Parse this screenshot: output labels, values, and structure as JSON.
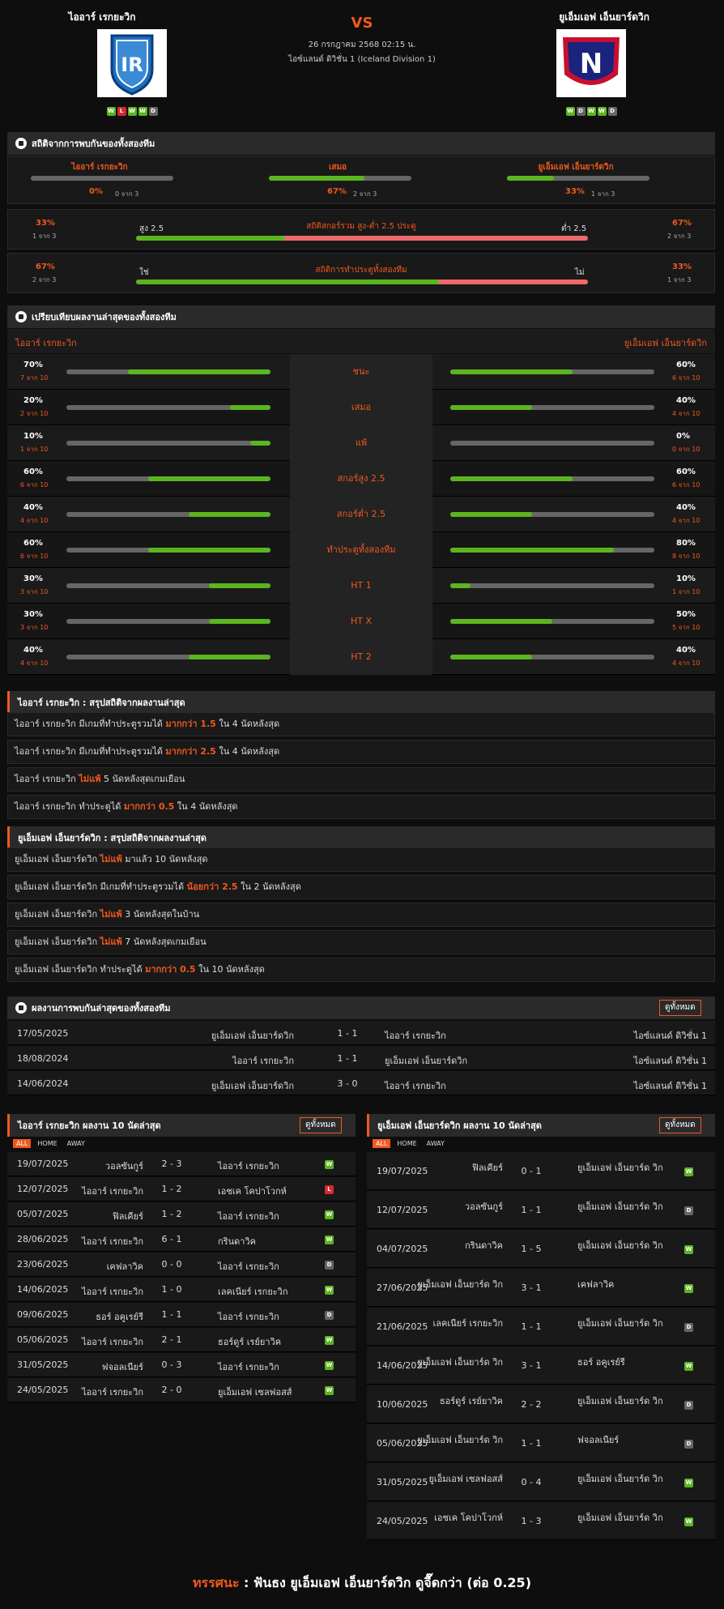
{
  "header": {
    "home": "ไออาร์ เรกยะวิก",
    "away": "ยูเอ็มเอฟ เอ็นยาร์ดวิก",
    "vs": "VS",
    "date": "26 กรกฎาคม 2568 02:15 น.",
    "league": "ไอซ์แลนด์ ดิวิชั่น 1 (Iceland Division 1)",
    "home_form": [
      "W",
      "L",
      "W",
      "W",
      "D"
    ],
    "away_form": [
      "W",
      "D",
      "W",
      "W",
      "D"
    ],
    "home_logo_text": "IR",
    "away_logo_text": "N"
  },
  "h2h_stats": {
    "title": "สถิติจากการพบกันของทั้งสองทีม",
    "cols": [
      {
        "name": "ไออาร์ เรกยะวิก",
        "pct": "0%",
        "sub": "0 จาก 3",
        "fill": 0
      },
      {
        "name": "เสมอ",
        "pct": "67%",
        "sub": "2 จาก 3",
        "fill": 0.67
      },
      {
        "name": "ยูเอ็มเอฟ เอ็นยาร์ดวิก",
        "pct": "33%",
        "sub": "1 จาก 3",
        "fill": 0.33
      }
    ],
    "ou": {
      "title": "สถิติสกอร์รวม สูง-ต่ำ 2.5 ประตู",
      "left_label": "สูง 2.5",
      "right_label": "ต่ำ 2.5",
      "left_pct": "33%",
      "left_sub": "1 จาก 3",
      "right_pct": "67%",
      "right_sub": "2 จาก 3",
      "fill": 0.33
    },
    "btts": {
      "title": "สถิติการทำประตูทั้งสองทีม",
      "left_label": "ใช่",
      "right_label": "ไม่",
      "left_pct": "67%",
      "left_sub": "2 จาก 3",
      "right_pct": "33%",
      "right_sub": "1 จาก 3",
      "fill": 0.67
    }
  },
  "compare": {
    "title": "เปรียบเทียบผลงานล่าสุดของทั้งสองทีม",
    "home": "ไออาร์ เรกยะวิก",
    "away": "ยูเอ็มเอฟ เอ็นยาร์ดวิก",
    "rows": [
      {
        "label": "ชนะ",
        "hp": "70%",
        "hs": "7 จาก 10",
        "hf": 0.7,
        "ap": "60%",
        "as": "6 จาก 10",
        "af": 0.6
      },
      {
        "label": "เสมอ",
        "hp": "20%",
        "hs": "2 จาก 10",
        "hf": 0.2,
        "ap": "40%",
        "as": "4 จาก 10",
        "af": 0.4
      },
      {
        "label": "แพ้",
        "hp": "10%",
        "hs": "1 จาก 10",
        "hf": 0.1,
        "ap": "0%",
        "as": "0 จาก 10",
        "af": 0
      },
      {
        "label": "สกอร์สูง 2.5",
        "hp": "60%",
        "hs": "6 จาก 10",
        "hf": 0.6,
        "ap": "60%",
        "as": "6 จาก 10",
        "af": 0.6
      },
      {
        "label": "สกอร์ต่ำ 2.5",
        "hp": "40%",
        "hs": "4 จาก 10",
        "hf": 0.4,
        "ap": "40%",
        "as": "4 จาก 10",
        "af": 0.4
      },
      {
        "label": "ทำประตูทั้งสองทีม",
        "hp": "60%",
        "hs": "6 จาก 10",
        "hf": 0.6,
        "ap": "80%",
        "as": "8 จาก 10",
        "af": 0.8
      },
      {
        "label": "HT 1",
        "hp": "30%",
        "hs": "3 จาก 10",
        "hf": 0.3,
        "ap": "10%",
        "as": "1 จาก 10",
        "af": 0.1
      },
      {
        "label": "HT X",
        "hp": "30%",
        "hs": "3 จาก 10",
        "hf": 0.3,
        "ap": "50%",
        "as": "5 จาก 10",
        "af": 0.5
      },
      {
        "label": "HT 2",
        "hp": "40%",
        "hs": "4 จาก 10",
        "hf": 0.4,
        "ap": "40%",
        "as": "4 จาก 10",
        "af": 0.4
      }
    ]
  },
  "home_summary": {
    "title": "ไออาร์ เรกยะวิก : สรุปสถิติจากผลงานล่าสุด",
    "lines": [
      [
        "ไออาร์ เรกยะวิก  มีเกมที่ทำประตูรวมได้ ",
        "มากกว่า 1.5",
        " ใน 4 นัดหลังสุด"
      ],
      [
        "ไออาร์ เรกยะวิก  มีเกมที่ทำประตูรวมได้ ",
        "มากกว่า 2.5",
        " ใน 4 นัดหลังสุด"
      ],
      [
        "ไออาร์ เรกยะวิก ",
        "ไม่แพ้",
        " 5 นัดหลังสุดเกมเยือน"
      ],
      [
        "ไออาร์ เรกยะวิก  ทำประตูได้ ",
        "มากกว่า 0.5",
        " ใน 4 นัดหลังสุด"
      ]
    ]
  },
  "away_summary": {
    "title": "ยูเอ็มเอฟ เอ็นยาร์ดวิก : สรุปสถิติจากผลงานล่าสุด",
    "lines": [
      [
        "ยูเอ็มเอฟ เอ็นยาร์ดวิก ",
        "ไม่แพ้",
        " มาแล้ว 10 นัดหลังสุด"
      ],
      [
        "ยูเอ็มเอฟ เอ็นยาร์ดวิก  มีเกมที่ทำประตูรวมได้ ",
        "น้อยกว่า 2.5",
        " ใน 2 นัดหลังสุด"
      ],
      [
        "ยูเอ็มเอฟ เอ็นยาร์ดวิก ",
        "ไม่แพ้",
        " 3 นัดหลังสุดในบ้าน"
      ],
      [
        "ยูเอ็มเอฟ เอ็นยาร์ดวิก ",
        "ไม่แพ้",
        " 7 นัดหลังสุดเกมเยือน"
      ],
      [
        "ยูเอ็มเอฟ เอ็นยาร์ดวิก  ทำประตูได้ ",
        "มากกว่า 0.5",
        " ใน 10 นัดหลังสุด"
      ]
    ]
  },
  "h2h": {
    "title": "ผลงานการพบกันล่าสุดของทั้งสองทีม",
    "button": "ดูทั้งหมด",
    "rows": [
      {
        "date": "17/05/2025",
        "home": "ยูเอ็มเอฟ เอ็นยาร์ดวิก",
        "score": "1 - 1",
        "away": "ไออาร์ เรกยะวิก",
        "league": "ไอซ์แลนด์ ดิวิชั่น 1"
      },
      {
        "date": "18/08/2024",
        "home": "ไออาร์ เรกยะวิก",
        "score": "1 - 1",
        "away": "ยูเอ็มเอฟ เอ็นยาร์ดวิก",
        "league": "ไอซ์แลนด์ ดิวิชั่น 1"
      },
      {
        "date": "14/06/2024",
        "home": "ยูเอ็มเอฟ เอ็นยาร์ดวิก",
        "score": "3 - 0",
        "away": "ไออาร์ เรกยะวิก",
        "league": "ไอซ์แลนด์ ดิวิชั่น 1"
      }
    ]
  },
  "home_last10": {
    "title": "ไออาร์ เรกยะวิก ผลงาน 10 นัดล่าสุด",
    "button": "ดูทั้งหมด",
    "tabs": [
      "ALL",
      "HOME",
      "AWAY"
    ],
    "rows": [
      {
        "date": "19/07/2025",
        "home": "วอลซันกูร์",
        "score": "2 - 3",
        "away": "ไออาร์ เรกยะวิก",
        "res": "W"
      },
      {
        "date": "12/07/2025",
        "home": "ไออาร์ เรกยะวิก",
        "score": "1 - 2",
        "away": "เอชเค โคปาโวกห์",
        "res": "L"
      },
      {
        "date": "05/07/2025",
        "home": "ฟิลเคียร์",
        "score": "1 - 2",
        "away": "ไออาร์ เรกยะวิก",
        "res": "W"
      },
      {
        "date": "28/06/2025",
        "home": "ไออาร์ เรกยะวิก",
        "score": "6 - 1",
        "away": "กรินดาวิค",
        "res": "W"
      },
      {
        "date": "23/06/2025",
        "home": "เคฟลาวิค",
        "score": "0 - 0",
        "away": "ไออาร์ เรกยะวิก",
        "res": "D"
      },
      {
        "date": "14/06/2025",
        "home": "ไออาร์ เรกยะวิก",
        "score": "1 - 0",
        "away": "เลคเนียร์ เรกยะวิก",
        "res": "W"
      },
      {
        "date": "09/06/2025",
        "home": "ธอร์ อคูเรย์รี",
        "score": "1 - 1",
        "away": "ไออาร์ เรกยะวิก",
        "res": "D"
      },
      {
        "date": "05/06/2025",
        "home": "ไออาร์ เรกยะวิก",
        "score": "2 - 1",
        "away": "ธอร์ดูร์ เรย์ยาวิค",
        "res": "W"
      },
      {
        "date": "31/05/2025",
        "home": "ฟจอลเนียร์",
        "score": "0 - 3",
        "away": "ไออาร์ เรกยะวิก",
        "res": "W"
      },
      {
        "date": "24/05/2025",
        "home": "ไออาร์ เรกยะวิก",
        "score": "2 - 0",
        "away": "ยูเอ็มเอฟ เซลฟอสส์",
        "res": "W"
      }
    ]
  },
  "away_last10": {
    "title": "ยูเอ็มเอฟ เอ็นยาร์ดวิก ผลงาน 10 นัดล่าสุด",
    "button": "ดูทั้งหมด",
    "tabs": [
      "ALL",
      "HOME",
      "AWAY"
    ],
    "rows": [
      {
        "date": "19/07/2025",
        "home": "ฟิลเคียร์",
        "score": "0 - 1",
        "away": "ยูเอ็มเอฟ เอ็นยาร์ด วิก",
        "res": "W"
      },
      {
        "date": "12/07/2025",
        "home": "วอลซันกูร์",
        "score": "1 - 1",
        "away": "ยูเอ็มเอฟ เอ็นยาร์ด วิก",
        "res": "D"
      },
      {
        "date": "04/07/2025",
        "home": "กรินดาวิค",
        "score": "1 - 5",
        "away": "ยูเอ็มเอฟ เอ็นยาร์ด วิก",
        "res": "W"
      },
      {
        "date": "27/06/2025",
        "home": "ยูเอ็มเอฟ เอ็นยาร์ด วิก",
        "score": "3 - 1",
        "away": "เคฟลาวิค",
        "res": "W"
      },
      {
        "date": "21/06/2025",
        "home": "เลคเนียร์ เรกยะวิก",
        "score": "1 - 1",
        "away": "ยูเอ็มเอฟ เอ็นยาร์ด วิก",
        "res": "D"
      },
      {
        "date": "14/06/2025",
        "home": "ยูเอ็มเอฟ เอ็นยาร์ด วิก",
        "score": "3 - 1",
        "away": "ธอร์ อคูเรย์รี",
        "res": "W"
      },
      {
        "date": "10/06/2025",
        "home": "ธอร์ดูร์ เรย์ยาวิค",
        "score": "2 - 2",
        "away": "ยูเอ็มเอฟ เอ็นยาร์ด วิก",
        "res": "D"
      },
      {
        "date": "05/06/2025",
        "home": "ยูเอ็มเอฟ เอ็นยาร์ด วิก",
        "score": "1 - 1",
        "away": "ฟจอลเนียร์",
        "res": "D"
      },
      {
        "date": "31/05/2025",
        "home": "ยูเอ็มเอฟ เซลฟอสส์",
        "score": "0 - 4",
        "away": "ยูเอ็มเอฟ เอ็นยาร์ด วิก",
        "res": "W"
      },
      {
        "date": "24/05/2025",
        "home": "เอชเค โคปาโวกห์",
        "score": "1 - 3",
        "away": "ยูเอ็มเอฟ เอ็นยาร์ด วิก",
        "res": "W"
      }
    ]
  },
  "footer": {
    "label": "ทรรศนะ",
    "sep": " : ",
    "text": " ฟันธง ยูเอ็มเอฟ เอ็นยาร์ดวิก ดูจื๊ดกว่า (ต่อ 0.25)"
  },
  "colors": {
    "accent": "#f0591d",
    "win": "#5bb51f",
    "loss": "#d8272d",
    "draw": "#666666",
    "bg": "#0e0e0e"
  }
}
